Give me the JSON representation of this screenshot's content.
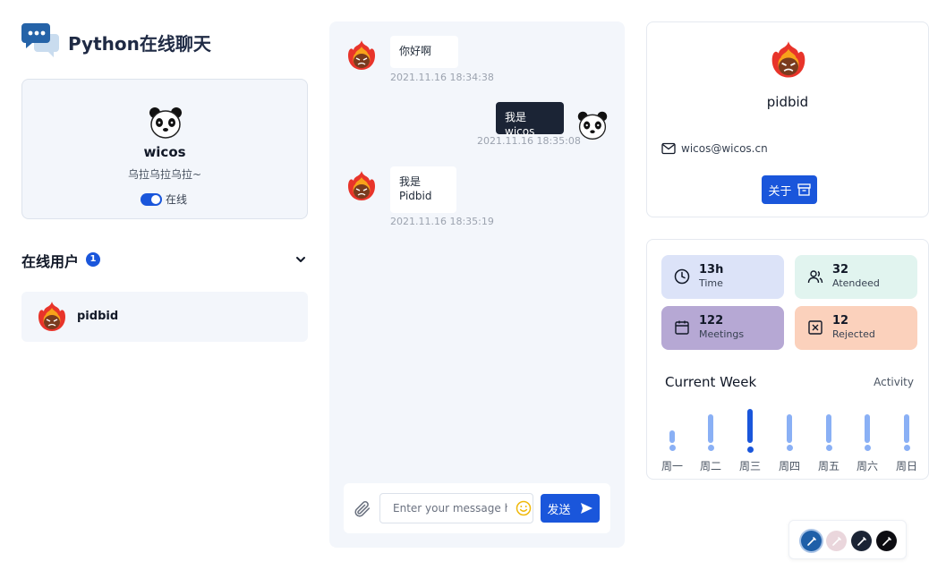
{
  "app": {
    "title": "Python在线聊天"
  },
  "profile": {
    "name": "wicos",
    "motto": "乌拉乌拉乌拉~",
    "status": "在线",
    "avatar_icon": "panda-avatar-icon"
  },
  "online": {
    "title": "在线用户",
    "count": "1",
    "users": [
      {
        "name": "pidbid",
        "avatar_icon": "fire-avatar-icon"
      }
    ]
  },
  "chat": {
    "messages": [
      {
        "sender": "pidbid",
        "side": "left",
        "text": "你好啊",
        "time": "2021.11.16 18:34:38"
      },
      {
        "sender": "wicos",
        "side": "right",
        "text": "我是wicos",
        "time": "2021.11.16 18:35:08"
      },
      {
        "sender": "pidbid",
        "side": "left",
        "text_line1": "我是",
        "text_line2": "Pidbid",
        "time": "2021.11.16 18:35:19"
      }
    ],
    "input_placeholder": "Enter your message here",
    "send_label": "发送"
  },
  "contact": {
    "name": "pidbid",
    "email": "wicos@wicos.cn",
    "about_label": "关于"
  },
  "stats": [
    {
      "value": "13h",
      "label": "Time",
      "icon": "clock-icon",
      "color": "#dce3f8"
    },
    {
      "value": "32",
      "label": "Atendeed",
      "icon": "users-icon",
      "color": "#e1f4ef"
    },
    {
      "value": "122",
      "label": "Meetings",
      "icon": "calendar-icon",
      "color": "#b6a8d4"
    },
    {
      "value": "12",
      "label": "Rejected",
      "icon": "x-square-icon",
      "color": "#fbd1bc"
    }
  ],
  "week": {
    "title": "Current Week",
    "activity_label": "Activity",
    "days": [
      "周一",
      "周二",
      "周三",
      "周四",
      "周五",
      "周六",
      "周日"
    ],
    "active_day": "周三"
  },
  "colors": {
    "primary": "#1a56db",
    "dark_bubble": "#1b2435",
    "panel_bg": "#f3f6fb"
  },
  "themes": [
    {
      "name": "blue",
      "color": "#1f5fa8"
    },
    {
      "name": "pink",
      "color": "#ead6dc"
    },
    {
      "name": "dark",
      "color": "#1b2435"
    },
    {
      "name": "black",
      "color": "#0d0d12"
    }
  ]
}
